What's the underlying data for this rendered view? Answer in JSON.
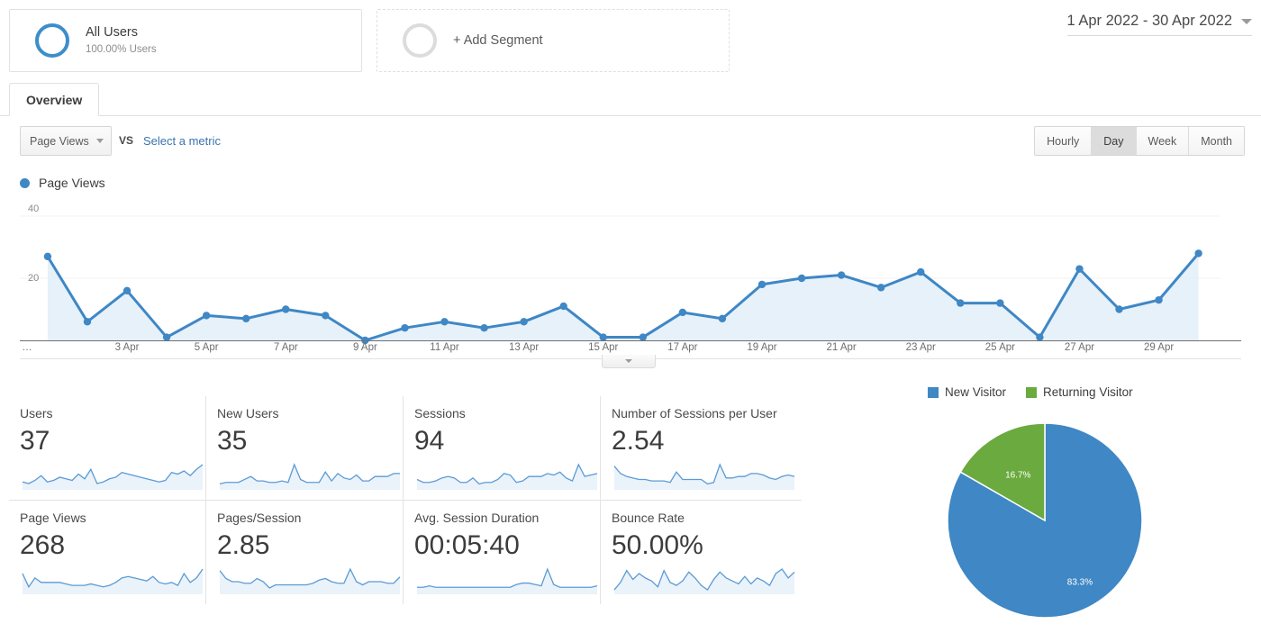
{
  "segments": {
    "all_users": {
      "title": "All Users",
      "subtitle": "100.00% Users"
    },
    "add_segment": {
      "label": "+ Add Segment"
    }
  },
  "date_range": {
    "value": "1 Apr 2022 - 30 Apr 2022"
  },
  "tabs": [
    {
      "label": "Overview",
      "active": true
    }
  ],
  "controls": {
    "metric_select": "Page Views",
    "vs": "VS",
    "select_metric_link": "Select a metric",
    "granularity": [
      {
        "label": "Hourly",
        "active": false
      },
      {
        "label": "Day",
        "active": true
      },
      {
        "label": "Week",
        "active": false
      },
      {
        "label": "Month",
        "active": false
      }
    ]
  },
  "chart_data": {
    "type": "line",
    "title": "Page Views",
    "xlabel": "",
    "ylabel": "Page Views",
    "ylim": [
      0,
      40
    ],
    "yticks": [
      20,
      40
    ],
    "grid": true,
    "legend": [
      "Page Views"
    ],
    "legend_position": "top-left",
    "accent_color": "#3f87c5",
    "fill_color": "#e2eef8",
    "x": [
      "1 Apr",
      "2 Apr",
      "3 Apr",
      "4 Apr",
      "5 Apr",
      "6 Apr",
      "7 Apr",
      "8 Apr",
      "9 Apr",
      "10 Apr",
      "11 Apr",
      "12 Apr",
      "13 Apr",
      "14 Apr",
      "15 Apr",
      "16 Apr",
      "17 Apr",
      "18 Apr",
      "19 Apr",
      "20 Apr",
      "21 Apr",
      "22 Apr",
      "23 Apr",
      "24 Apr",
      "25 Apr",
      "26 Apr",
      "27 Apr",
      "28 Apr",
      "29 Apr",
      "30 Apr"
    ],
    "tick_labels": [
      "…",
      "3 Apr",
      "5 Apr",
      "7 Apr",
      "9 Apr",
      "11 Apr",
      "13 Apr",
      "15 Apr",
      "17 Apr",
      "19 Apr",
      "21 Apr",
      "23 Apr",
      "25 Apr",
      "27 Apr",
      "29 Apr"
    ],
    "values": [
      27,
      6,
      16,
      1,
      8,
      7,
      10,
      8,
      0,
      4,
      6,
      4,
      6,
      11,
      1,
      1,
      9,
      7,
      18,
      20,
      21,
      17,
      22,
      12,
      12,
      1,
      23,
      10,
      13,
      28
    ]
  },
  "metric_cards": [
    {
      "label": "Users",
      "value": "37",
      "spark": [
        5,
        4,
        6,
        9,
        5,
        6,
        8,
        7,
        6,
        10,
        7,
        13,
        4,
        5,
        7,
        8,
        11,
        10,
        9,
        8,
        7,
        6,
        5,
        6,
        11,
        10,
        12,
        9,
        13,
        16
      ]
    },
    {
      "label": "New Users",
      "value": "35",
      "spark": [
        4,
        5,
        5,
        5,
        7,
        9,
        6,
        6,
        5,
        5,
        6,
        5,
        17,
        7,
        5,
        5,
        5,
        12,
        6,
        11,
        8,
        7,
        10,
        6,
        6,
        9,
        9,
        9,
        11,
        11
      ]
    },
    {
      "label": "Sessions",
      "value": "94",
      "spark": [
        7,
        5,
        5,
        6,
        8,
        9,
        8,
        5,
        5,
        8,
        4,
        5,
        5,
        7,
        11,
        10,
        5,
        6,
        9,
        9,
        9,
        11,
        10,
        12,
        8,
        6,
        17,
        9,
        10,
        11
      ]
    },
    {
      "label": "Number of Sessions per User",
      "value": "2.54",
      "spark": [
        16,
        11,
        9,
        8,
        7,
        7,
        6,
        6,
        6,
        5,
        12,
        7,
        7,
        7,
        7,
        4,
        5,
        17,
        8,
        8,
        9,
        9,
        11,
        11,
        10,
        8,
        7,
        9,
        10,
        9
      ]
    },
    {
      "label": "Page Views",
      "value": "268",
      "spark": [
        14,
        5,
        11,
        8,
        8,
        8,
        8,
        7,
        6,
        6,
        6,
        7,
        6,
        5,
        6,
        8,
        11,
        12,
        11,
        10,
        9,
        12,
        8,
        7,
        8,
        6,
        14,
        8,
        11,
        17
      ]
    },
    {
      "label": "Pages/Session",
      "value": "2.85",
      "spark": [
        15,
        10,
        8,
        8,
        7,
        7,
        10,
        8,
        4,
        6,
        6,
        6,
        6,
        6,
        6,
        7,
        9,
        10,
        8,
        7,
        7,
        16,
        8,
        6,
        8,
        8,
        8,
        7,
        7,
        11
      ]
    },
    {
      "label": "Avg. Session Duration",
      "value": "00:05:40",
      "spark": [
        5,
        5,
        6,
        5,
        5,
        5,
        5,
        5,
        5,
        5,
        5,
        5,
        5,
        5,
        5,
        5,
        7,
        8,
        8,
        7,
        6,
        18,
        7,
        5,
        5,
        5,
        5,
        5,
        5,
        6
      ]
    },
    {
      "label": "Bounce Rate",
      "value": "50.00%",
      "spark": [
        3,
        8,
        16,
        10,
        14,
        11,
        9,
        5,
        16,
        8,
        6,
        9,
        15,
        11,
        6,
        3,
        10,
        15,
        11,
        9,
        7,
        12,
        7,
        11,
        9,
        6,
        14,
        17,
        11,
        15
      ]
    }
  ],
  "pie": {
    "type": "pie",
    "title": "",
    "legend_position": "top",
    "slices": [
      {
        "label": "New Visitor",
        "value": 83.3,
        "display": "83.3%",
        "color": "#3f87c5"
      },
      {
        "label": "Returning Visitor",
        "value": 16.7,
        "display": "16.7%",
        "color": "#6aaa3f"
      }
    ]
  },
  "icons": {
    "caret_down": "chevron-down-icon",
    "drag_handle": "collapse-handle-icon"
  }
}
